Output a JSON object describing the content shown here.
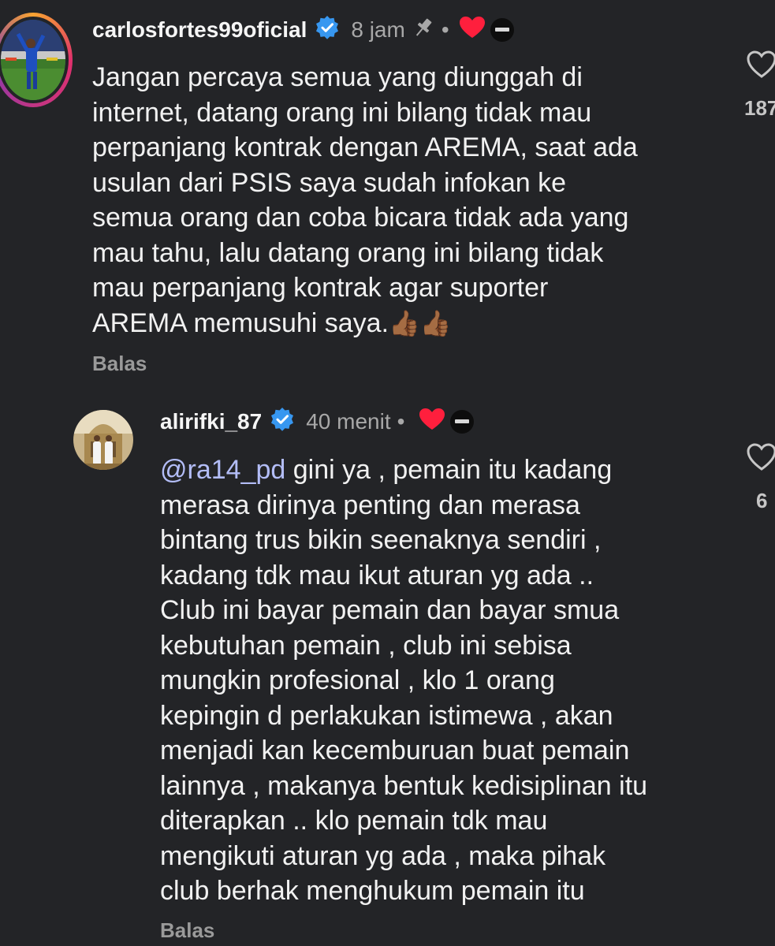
{
  "comments": [
    {
      "username": "carlosfortes99oficial",
      "time": "8 jam",
      "pinned": true,
      "creator_liked": true,
      "text": "Jangan percaya semua yang diunggah di\ninternet, datang orang ini bilang tidak mau\nperpanjang kontrak dengan AREMA, saat ada\nusulan dari PSIS saya sudah infokan ke\nsemua orang dan coba bicara tidak ada yang\nmau tahu, lalu datang orang ini bilang tidak\nmau perpanjang kontrak agar suporter\nAREMA memusuhi saya.",
      "emoji": "👍🏾👍🏾",
      "like_count": "187",
      "reply_label": "Balas"
    },
    {
      "username": "alirifki_87",
      "time": "40 menit",
      "pinned": false,
      "creator_liked": true,
      "mention": "@ra14_pd",
      "text": " gini ya , pemain itu kadang\nmerasa dirinya penting dan merasa\nbintang trus bikin seenaknya sendiri ,\nkadang tdk mau ikut aturan yg ada ..\nClub ini bayar pemain dan bayar smua\nkebutuhan pemain , club ini sebisa\nmungkin profesional , klo 1 orang\nkepingin d perlakukan istimewa , akan\nmenjadi kan kecemburuan buat pemain\nlainnya , makanya bentuk kedisiplinan itu\nditerapkan .. klo pemain tdk mau\nmengikuti aturan yg ada , maka pihak\nclub berhak menghukum pemain itu",
      "like_count": "6",
      "reply_label": "Balas"
    }
  ],
  "ui": {
    "dot": "•",
    "verified_color": "#3797f0",
    "heart_color": "#ff1f3d",
    "mention_color": "#b3bdf7",
    "background": "#232427"
  }
}
